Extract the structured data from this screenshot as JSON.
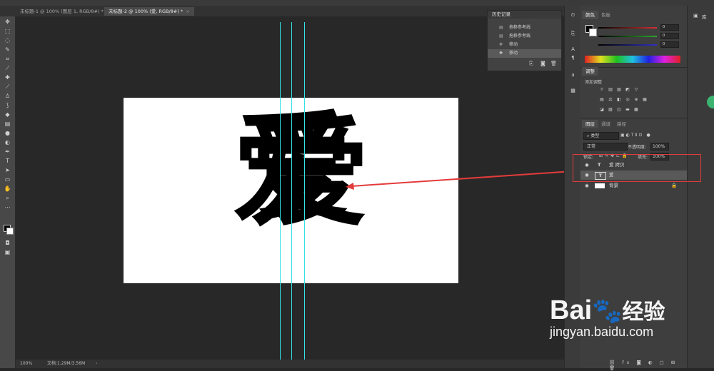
{
  "app": {
    "tabs": [
      {
        "label": "未标题-1 @ 100% (图层 1, RGB/8#) *",
        "close": "×"
      },
      {
        "label": "未标题-2 @ 100% (爱, RGB/8#) *",
        "close": "×"
      }
    ],
    "status": {
      "zoom": "100%",
      "doc_info": "文档:1.29M/3.56M"
    }
  },
  "canvas": {
    "glyph": "爱",
    "guide_color": "#35e1e6"
  },
  "history": {
    "title": "历史记录",
    "items": [
      {
        "label": "拖移参考线"
      },
      {
        "label": "拖移参考线"
      },
      {
        "label": "移动"
      },
      {
        "label": "移动",
        "selected": true
      }
    ]
  },
  "color_panel": {
    "tabs": [
      "颜色",
      "色板"
    ],
    "rows": [
      {
        "value": "0",
        "color": "#d43030"
      },
      {
        "value": "0",
        "color": "#2aa82a"
      },
      {
        "value": "0",
        "color": "#3030c8"
      }
    ]
  },
  "adjust_panel": {
    "title": "调整",
    "subtitle": "添加调整"
  },
  "layers_panel": {
    "tabs": [
      "图层",
      "通道",
      "路径"
    ],
    "filter_label": "类型",
    "blend_mode": "正常",
    "opacity_label": "不透明度:",
    "opacity_value": "100%",
    "lock_label": "锁定:",
    "fill_label": "填充:",
    "fill_value": "100%",
    "layers": [
      {
        "name": "爱 拷贝",
        "type": "T"
      },
      {
        "name": "爱",
        "type": "T"
      },
      {
        "name": "背景",
        "type": "image"
      }
    ]
  },
  "far_panel": {
    "library_label": "库"
  },
  "watermark": {
    "brand": "Bai",
    "brand2": "经验",
    "domain": "jingyan.baidu.com"
  }
}
